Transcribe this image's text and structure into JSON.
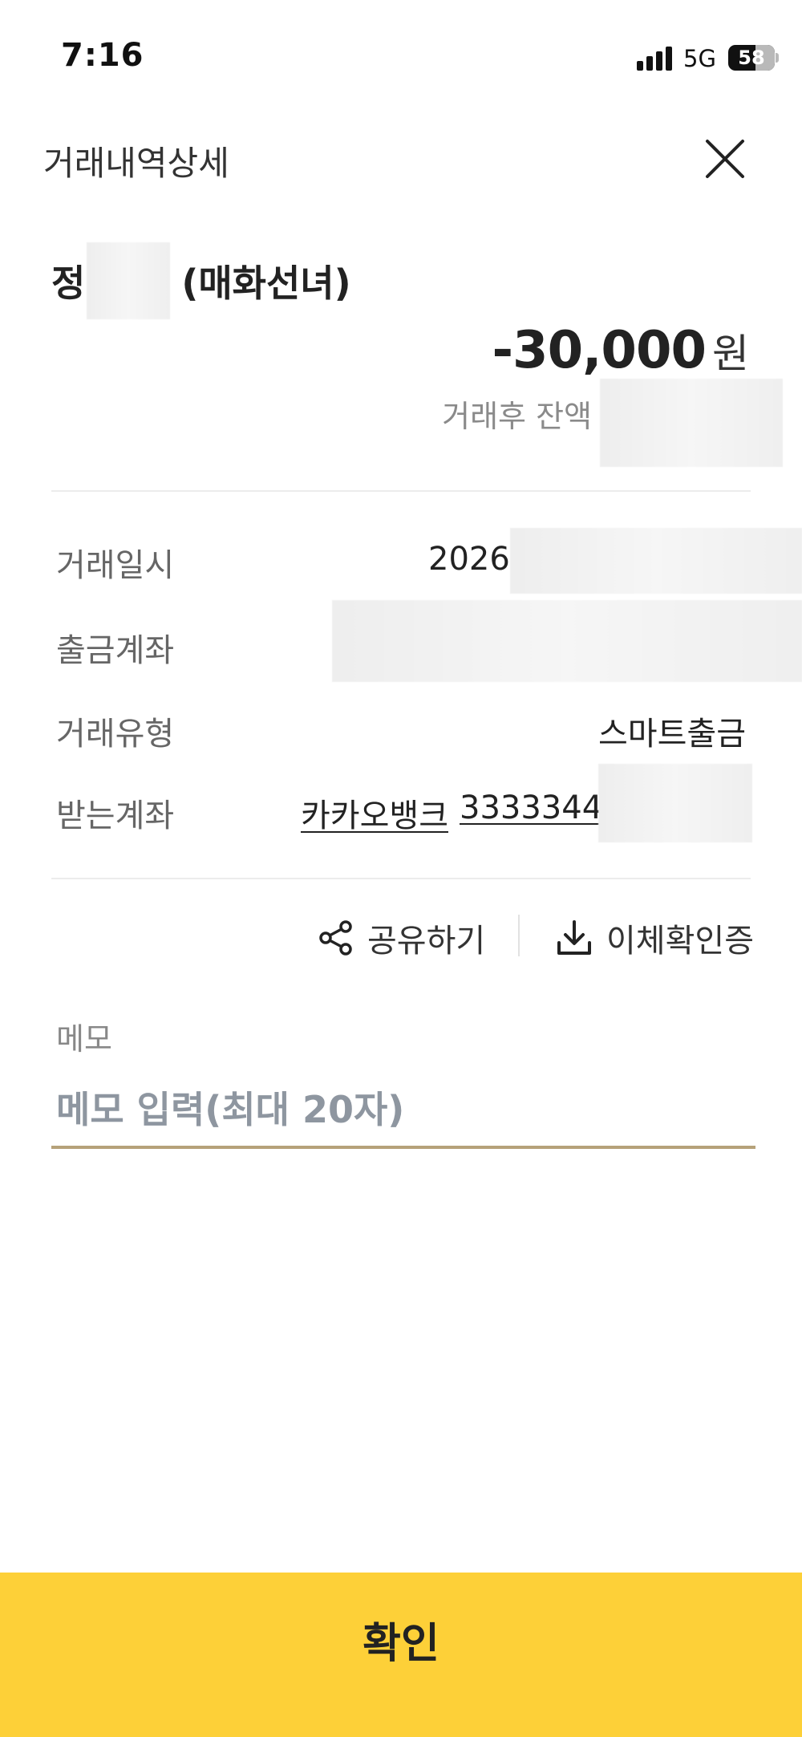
{
  "status_bar": {
    "time": "7:16",
    "network": "5G",
    "battery_percent": "58",
    "battery_level": 0.58,
    "signal_bars": 4
  },
  "header": {
    "title": "거래내역상세",
    "close_icon": "close-icon"
  },
  "transaction": {
    "recipient_prefix": "정",
    "recipient_suffix": "(매화선녀)",
    "amount": "-30,000",
    "currency": "원",
    "balance_label": "거래후 잔액"
  },
  "details": {
    "datetime_label": "거래일시",
    "datetime_value": "2026.",
    "from_account_label": "출금계좌",
    "type_label": "거래유형",
    "type_value": "스마트출금",
    "to_account_label": "받는계좌",
    "to_bank": "카카오뱅크",
    "to_account_number": "3333344"
  },
  "actions": {
    "share_label": "공유하기",
    "share_icon": "share-icon",
    "certificate_label": "이체확인증",
    "certificate_icon": "download-icon"
  },
  "memo": {
    "label": "메모",
    "placeholder": "메모 입력(최대 20자)",
    "value": ""
  },
  "confirm": {
    "label": "확인"
  },
  "colors": {
    "accent_yellow": "#fdd038",
    "memo_underline": "#b6a27a",
    "text_primary": "#222222",
    "text_secondary": "#666666"
  }
}
